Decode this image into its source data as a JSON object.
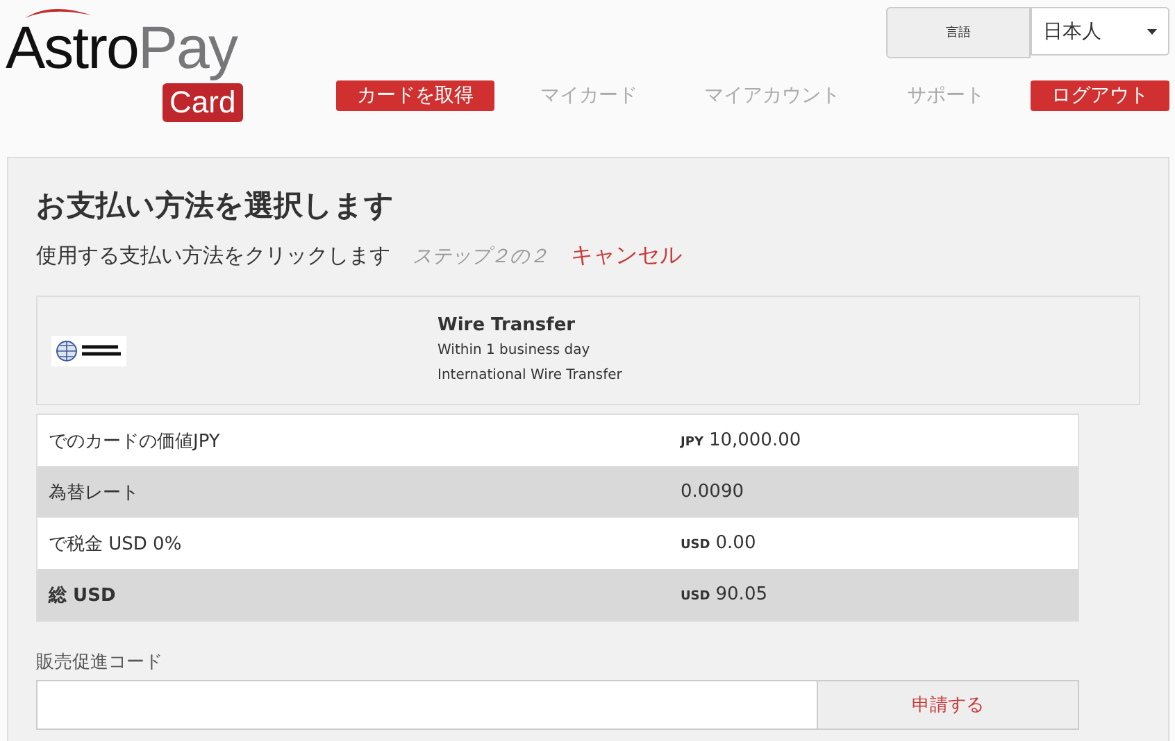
{
  "logo": {
    "primary": "Astro",
    "secondary": "Pay",
    "badge": "Card"
  },
  "language": {
    "label": "言語",
    "value": "日本人"
  },
  "nav": [
    {
      "label": "カードを取得",
      "highlighted": true
    },
    {
      "label": "マイカード",
      "highlighted": false
    },
    {
      "label": "マイアカウント",
      "highlighted": false
    },
    {
      "label": "サポート",
      "highlighted": false
    },
    {
      "label": "ログアウト",
      "highlighted": true
    }
  ],
  "panel": {
    "title": "お支払い方法を選択します",
    "subtitle": "使用する支払い方法をクリックします",
    "step": "ステップ２の２",
    "cancel": "キャンセル"
  },
  "method": {
    "name": "Wire Transfer",
    "details": [
      "Within 1 business day",
      "International Wire Transfer"
    ]
  },
  "summary": [
    {
      "label": "でのカードの価値JPY",
      "currency": "JPY",
      "value": "10,000.00",
      "shaded": false,
      "bold": false
    },
    {
      "label": "為替レート",
      "value": "0.0090",
      "shaded": true,
      "bold": false
    },
    {
      "label": "で税金 USD 0%",
      "currency": "USD",
      "value": "0.00",
      "shaded": false,
      "bold": false
    },
    {
      "label": "総 USD",
      "currency": "USD",
      "value": "90.05",
      "shaded": true,
      "bold": true
    }
  ],
  "promo": {
    "label": "販売促進コード",
    "button": "申請する"
  }
}
